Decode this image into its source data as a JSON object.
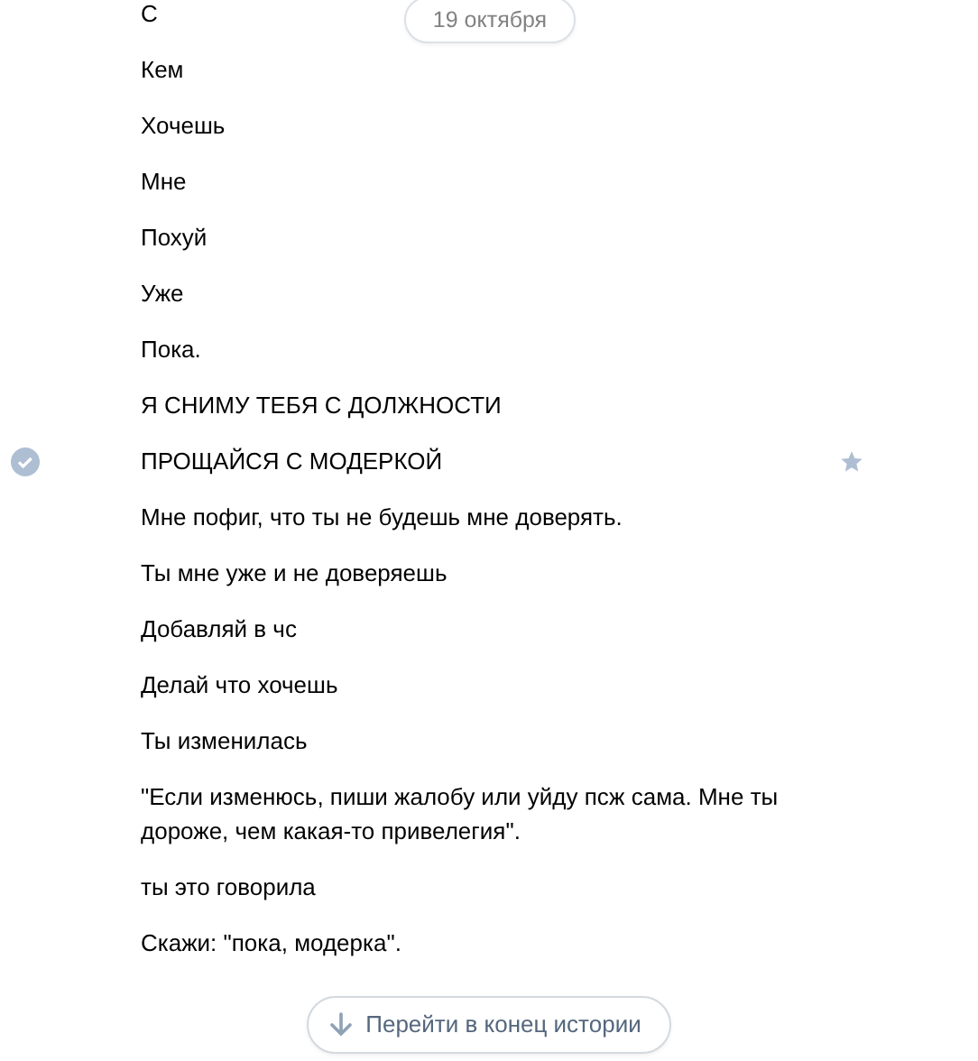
{
  "date_pill": "19 октября",
  "messages": [
    {
      "text": "С",
      "hovered": false
    },
    {
      "text": "Кем",
      "hovered": false
    },
    {
      "text": "Хочешь",
      "hovered": false
    },
    {
      "text": "Мне",
      "hovered": false
    },
    {
      "text": "Похуй",
      "hovered": false
    },
    {
      "text": "Уже",
      "hovered": false
    },
    {
      "text": "Пока.",
      "hovered": false
    },
    {
      "text": "Я СНИМУ ТЕБЯ С ДОЛЖНОСТИ",
      "hovered": false
    },
    {
      "text": "ПРОЩАЙСЯ С МОДЕРКОЙ",
      "hovered": true
    },
    {
      "text": "Мне пофиг, что ты не будешь мне доверять.",
      "hovered": false
    },
    {
      "text": "Ты мне уже и не доверяешь",
      "hovered": false
    },
    {
      "text": "Добавляй в чс",
      "hovered": false
    },
    {
      "text": "Делай что хочешь",
      "hovered": false
    },
    {
      "text": "Ты изменилась",
      "hovered": false
    },
    {
      "text": "\"Если изменюсь, пиши жалобу или уйду псж сама. Мне ты дороже, чем какая-то привелегия\".",
      "hovered": false
    },
    {
      "text": "ты это говорила",
      "hovered": false
    },
    {
      "text": "Скажи: \"пока, модерка\".",
      "hovered": false
    }
  ],
  "jump_button": "Перейти в конец истории"
}
